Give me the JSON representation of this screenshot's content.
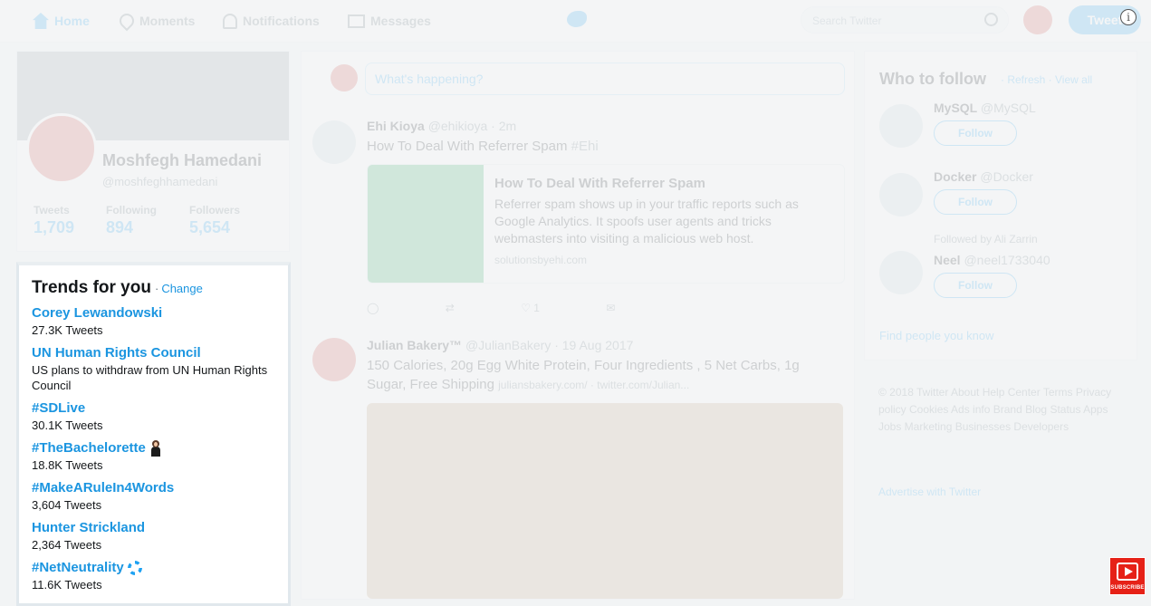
{
  "nav": {
    "home": "Home",
    "moments": "Moments",
    "notifications": "Notifications",
    "messages": "Messages",
    "search_placeholder": "Search Twitter",
    "tweet_button": "Tweet"
  },
  "profile": {
    "name": "Moshfegh Hamedani",
    "handle": "@moshfeghhamedani",
    "stats": [
      {
        "label": "Tweets",
        "value": "1,709"
      },
      {
        "label": "Following",
        "value": "894"
      },
      {
        "label": "Followers",
        "value": "5,654"
      }
    ]
  },
  "trends": {
    "title": "Trends for you",
    "separator": "·",
    "change": "Change",
    "items": [
      {
        "name": "Corey Lewandowski",
        "sub": "27.3K Tweets"
      },
      {
        "name": "UN Human Rights Council",
        "sub": "US plans to withdraw from UN Human Rights Council"
      },
      {
        "name": "#SDLive",
        "sub": "30.1K Tweets"
      },
      {
        "name": "#TheBachelorette",
        "sub": "18.8K Tweets"
      },
      {
        "name": "#MakeARuleIn4Words",
        "sub": "3,604 Tweets"
      },
      {
        "name": "Hunter Strickland",
        "sub": "2,364 Tweets"
      },
      {
        "name": "#NetNeutrality",
        "sub": "11.6K Tweets"
      }
    ]
  },
  "timeline": {
    "compose_placeholder": "What's happening?",
    "tweets": [
      {
        "name": "Ehi Kioya",
        "handle": "@ehikioya",
        "time": "· 2m",
        "text": "How To Deal With Referrer Spam",
        "link": "#Ehi",
        "card": {
          "title": "How To Deal With Referrer Spam",
          "desc": "Referrer spam shows up in your traffic reports such as Google Analytics. It spoofs user agents and tricks webmasters into visiting a malicious web host.",
          "url": "solutionsbyehi.com"
        },
        "likes": "1"
      },
      {
        "name": "Julian Bakery™",
        "handle": "@JulianBakery",
        "time": "· 19 Aug 2017",
        "text": "150 Calories, 20g Egg White Protein, Four Ingredients , 5 Net Carbs, 1g Sugar, Free Shipping",
        "link": "juliansbakery.com/ · twitter.com/Julian..."
      }
    ]
  },
  "who_to_follow": {
    "title": "Who to follow",
    "links": "· Refresh · View all",
    "follow_label": "Follow",
    "items": [
      {
        "name": "MySQL",
        "handle": "@MySQL",
        "followed_by": ""
      },
      {
        "name": "Docker",
        "handle": "@Docker",
        "followed_by": ""
      },
      {
        "name": "Neel",
        "handle": "@neel1733040",
        "followed_by": "Followed by Ali Zarrin"
      }
    ],
    "find_people": "Find people you know"
  },
  "footer": {
    "links": "© 2018 Twitter  About  Help Center  Terms  Privacy policy  Cookies  Ads info  Brand  Blog  Status  Apps  Jobs  Marketing  Businesses  Developers",
    "ads_info": "Advertise with Twitter"
  },
  "overlay": {
    "info_icon_glyph": "i",
    "subscribe_label": "SUBSCRIBE"
  },
  "colors": {
    "accent": "#1da1f2",
    "trend_link": "#1b95e0",
    "subscribe_red": "#e62117"
  }
}
